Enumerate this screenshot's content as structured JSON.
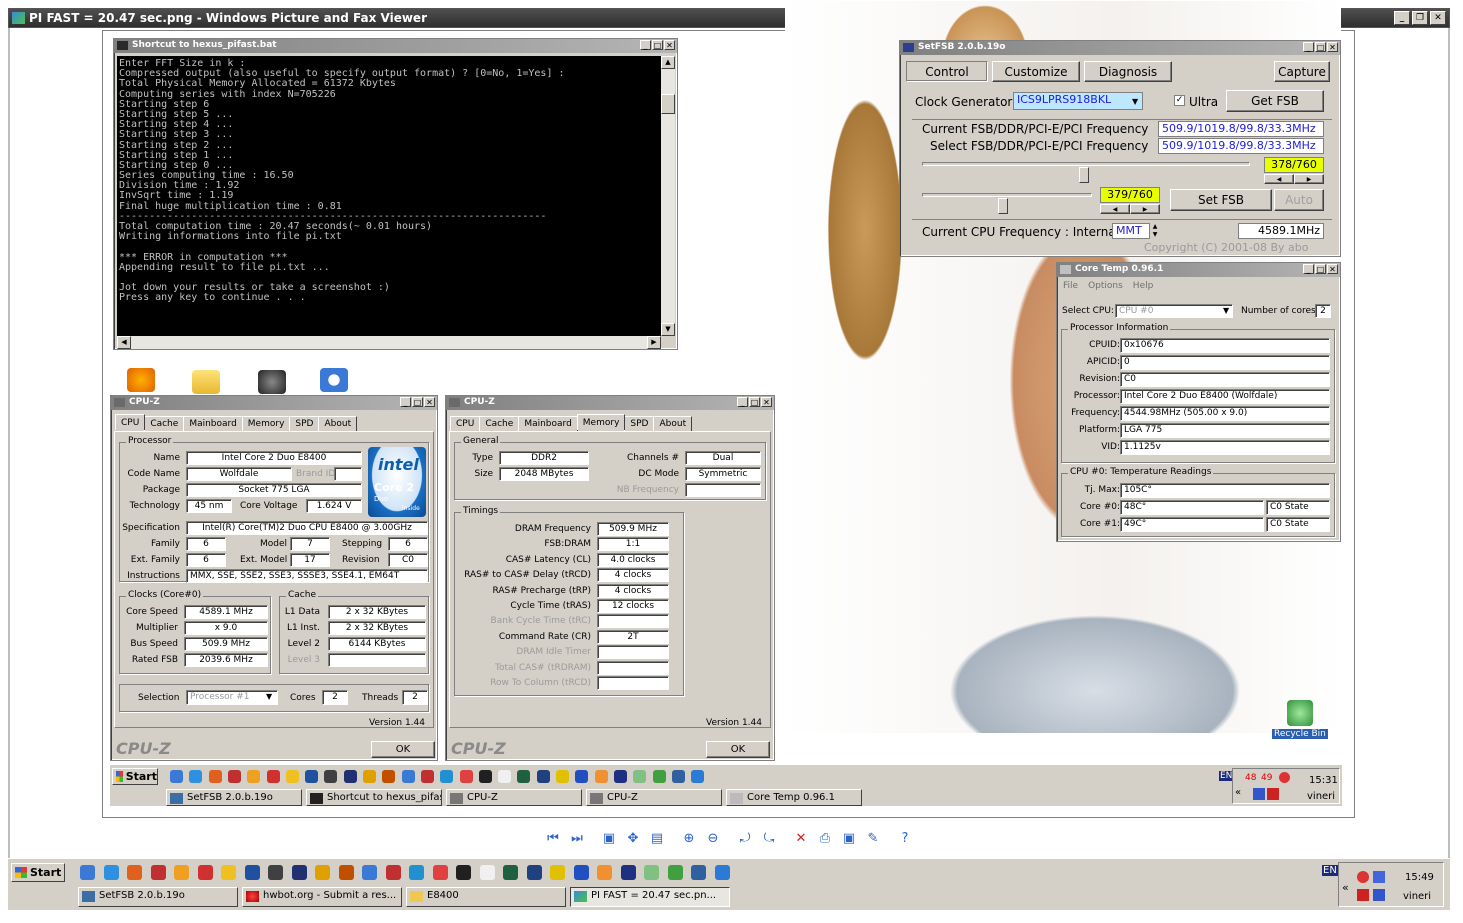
{
  "viewer": {
    "title": "PI FAST = 20.47 sec.png - Windows Picture and Fax Viewer",
    "toolbar_icons": [
      "prev-image-icon",
      "next-image-icon",
      "best-fit-icon",
      "actual-size-icon",
      "slideshow-icon",
      "zoom-in-icon",
      "zoom-out-icon",
      "rotate-cw-icon",
      "rotate-ccw-icon",
      "delete-icon",
      "print-icon",
      "save-icon",
      "edit-icon",
      "help-icon"
    ]
  },
  "console": {
    "title": "Shortcut to hexus_pifast.bat",
    "lines": [
      "Enter FFT Size in k :",
      "Compressed output (also useful to specify output format) ? [0=No, 1=Yes] :",
      "Total Physical Memory Allocated = 61372 Kbytes",
      "Computing series with index N=705226",
      "Starting step 6",
      "Starting step 5 ...",
      "Starting step 4 ...",
      "Starting step 3 ...",
      "Starting step 2 ...",
      "Starting step 1 ...",
      "Starting step 0 ...",
      "Series computing time : 16.50",
      "Division time : 1.92",
      "InvSqrt time : 1.19",
      "Final huge multiplication time : 0.81",
      "-----------------------------------------------------------------------",
      "Total computation time : 20.47 seconds(~ 0.01 hours)",
      "Writing informations into file pi.txt",
      "",
      "*** ERROR in computation ***",
      "Appending result to file pi.txt ...",
      "",
      "Jot down your results or take a screenshot :)",
      "Press any key to continue . . ."
    ]
  },
  "cpuz_cpu": {
    "title": "CPU-Z",
    "tabs": [
      "CPU",
      "Cache",
      "Mainboard",
      "Memory",
      "SPD",
      "About"
    ],
    "processor_label": "Processor",
    "name_label": "Name",
    "name": "Intel Core 2 Duo E8400",
    "codename_label": "Code Name",
    "codename": "Wolfdale",
    "brandid_label": "Brand ID",
    "package_label": "Package",
    "package": "Socket 775 LGA",
    "technology_label": "Technology",
    "technology": "45 nm",
    "corevoltage_label": "Core Voltage",
    "corevoltage": "1.624 V",
    "spec_label": "Specification",
    "spec": "Intel(R) Core(TM)2 Duo CPU     E8400  @ 3.00GHz",
    "family_label": "Family",
    "family": "6",
    "model_label": "Model",
    "model": "7",
    "stepping_label": "Stepping",
    "stepping": "6",
    "extfamily_label": "Ext. Family",
    "extfamily": "6",
    "extmodel_label": "Ext. Model",
    "extmodel": "17",
    "revision_label": "Revision",
    "revision": "C0",
    "instructions_label": "Instructions",
    "instructions": "MMX, SSE, SSE2, SSE3, SSSE3, SSE4.1, EM64T",
    "clocks_label": "Clocks (Core#0)",
    "corespeed_label": "Core Speed",
    "corespeed": "4589.1 MHz",
    "multiplier_label": "Multiplier",
    "multiplier": "x 9.0",
    "busspeed_label": "Bus Speed",
    "busspeed": "509.9 MHz",
    "ratedfsb_label": "Rated FSB",
    "ratedfsb": "2039.6 MHz",
    "cache_label": "Cache",
    "l1data_label": "L1 Data",
    "l1data": "2 x 32 KBytes",
    "l1inst_label": "L1 Inst.",
    "l1inst": "2 x 32 KBytes",
    "level2_label": "Level 2",
    "level2": "6144 KBytes",
    "level3_label": "Level 3",
    "selection_label": "Selection",
    "selection": "Processor #1",
    "cores_label": "Cores",
    "cores": "2",
    "threads_label": "Threads",
    "threads": "2",
    "version": "Version 1.44",
    "logo": "CPU-Z",
    "ok": "OK",
    "intel_logo": "intel",
    "intel_core": "Core 2",
    "intel_duo": "Duo",
    "intel_inside": "inside"
  },
  "cpuz_mem": {
    "title": "CPU-Z",
    "tabs": [
      "CPU",
      "Cache",
      "Mainboard",
      "Memory",
      "SPD",
      "About"
    ],
    "general_label": "General",
    "type_label": "Type",
    "type": "DDR2",
    "size_label": "Size",
    "size": "2048 MBytes",
    "channels_label": "Channels #",
    "channels": "Dual",
    "dcmode_label": "DC Mode",
    "dcmode": "Symmetric",
    "nbfreq_label": "NB Frequency",
    "timings_label": "Timings",
    "dramfreq_label": "DRAM Frequency",
    "dramfreq": "509.9 MHz",
    "fsbdram_label": "FSB:DRAM",
    "fsbdram": "1:1",
    "cas_label": "CAS# Latency (CL)",
    "cas": "4.0 clocks",
    "rcd_label": "RAS# to CAS# Delay (tRCD)",
    "rcd": "4 clocks",
    "rp_label": "RAS# Precharge (tRP)",
    "rp": "4 clocks",
    "ras_label": "Cycle Time (tRAS)",
    "ras": "12 clocks",
    "rc_label": "Bank Cycle Time (tRC)",
    "cr_label": "Command Rate (CR)",
    "cr": "2T",
    "idle_label": "DRAM Idle Timer",
    "rdram_label": "Total CAS# (tRDRAM)",
    "rtc_label": "Row To Column (tRCD)",
    "version": "Version 1.44",
    "logo": "CPU-Z",
    "ok": "OK"
  },
  "setfsb": {
    "title": "SetFSB 2.0.b.19o",
    "tabs": [
      "Control",
      "Customize",
      "Diagnosis",
      "Capture"
    ],
    "clockgen_label": "Clock Generator",
    "clockgen": "ICS9LPRS918BKL",
    "ultra_label": "Ultra",
    "getfsb": "Get FSB",
    "current_label": "Current FSB/DDR/PCI-E/PCI Frequency",
    "current": "509.9/1019.8/99.8/33.3MHz",
    "select_label": "Select FSB/DDR/PCI-E/PCI Frequency",
    "select": "509.9/1019.8/99.8/33.3MHz",
    "slider1": "378/760",
    "slider2": "379/760",
    "setfsb": "Set FSB",
    "auto": "Auto",
    "cpufreq_label": "Current CPU Frequency : Internal",
    "mmt": "MMT",
    "cpufreq": "4589.1MHz",
    "copyright": "Copyright (C) 2001-08 By abo"
  },
  "coretemp": {
    "title": "Core Temp 0.96.1",
    "menu": [
      "File",
      "Options",
      "Help"
    ],
    "selectcpu_label": "Select CPU:",
    "selectcpu": "CPU #0",
    "numcores_label": "Number of cores",
    "numcores": "2",
    "procinfo_label": "Processor Information",
    "cpuid_label": "CPUID:",
    "cpuid": "0x10676",
    "apicid_label": "APICID:",
    "apicid": "0",
    "revision_label": "Revision:",
    "revision": "C0",
    "processor_label": "Processor:",
    "processor": "Intel Core 2 Duo E8400 (Wolfdale)",
    "frequency_label": "Frequency:",
    "frequency": "4544.98MHz (505.00 x 9.0)",
    "platform_label": "Platform:",
    "platform": "LGA 775",
    "vid_label": "VID:",
    "vid": "1.1125v",
    "temps_label": "CPU #0: Temperature Readings",
    "tjmax_label": "Tj. Max:",
    "tjmax": "105C°",
    "core0_label": "Core #0:",
    "core0": "48C°",
    "core0_state": "C0 State",
    "core1_label": "Core #1:",
    "core1": "49C°",
    "core1_state": "C0 State"
  },
  "desktop": {
    "recycle_bin": "Recycle Bin"
  },
  "taskbar_inner": {
    "start": "Start",
    "buttons": [
      "SetFSB 2.0.b.19o",
      "Shortcut to hexus_pifast...",
      "CPU-Z",
      "CPU-Z",
      "Core Temp 0.96.1"
    ],
    "lang": "EN",
    "temp1": "48",
    "temp2": "49",
    "clock": "15:31",
    "day": "vineri"
  },
  "taskbar_main": {
    "start": "Start",
    "buttons": [
      "SetFSB 2.0.b.19o",
      "hwbot.org - Submit a res...",
      "E8400",
      "PI FAST = 20.47 sec.pn..."
    ],
    "lang": "EN",
    "clock": "15:49",
    "day": "vineri"
  }
}
